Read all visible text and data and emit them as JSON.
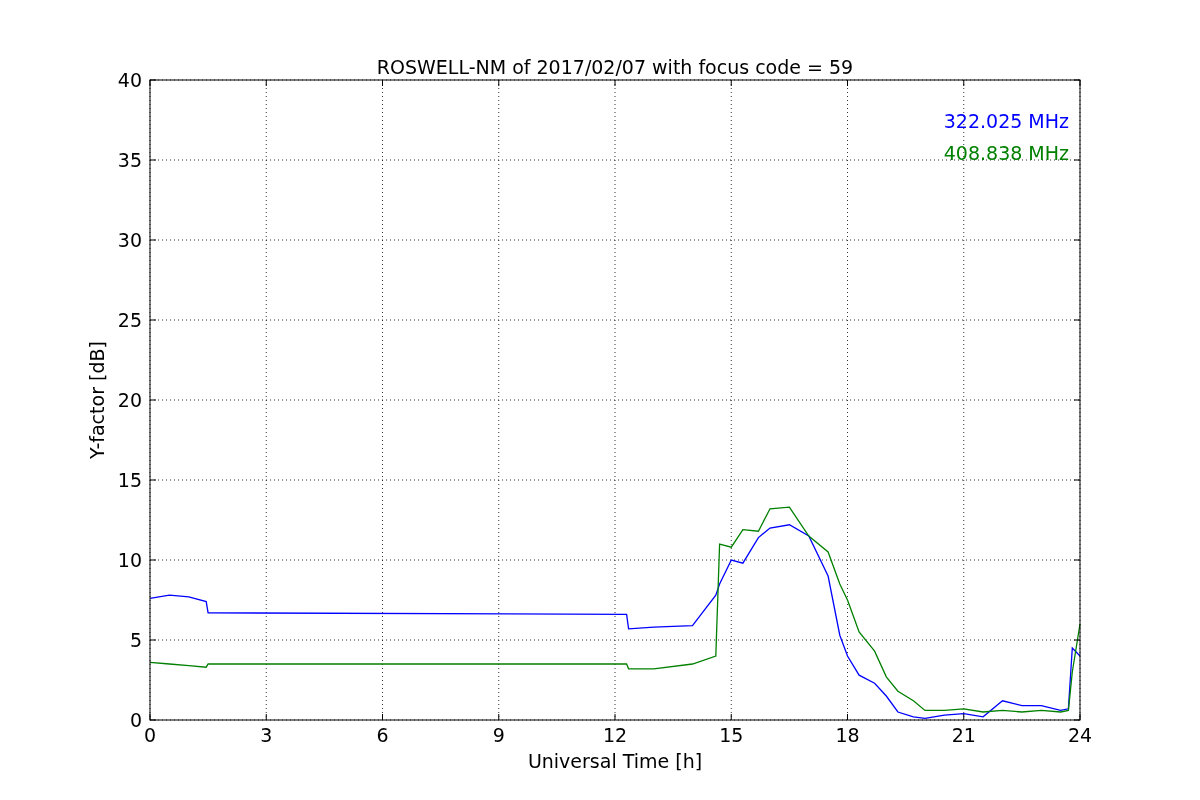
{
  "figure": {
    "chart_data": {
      "type": "line",
      "title": "ROSWELL-NM of 2017/02/07 with focus code = 59",
      "xlabel": "Universal Time [h]",
      "ylabel": "Y-factor [dB]",
      "x": [
        0,
        0.5,
        1,
        1.45,
        1.5,
        12.3,
        12.35,
        13,
        14,
        14.6,
        14.7,
        15,
        15.3,
        15.7,
        16,
        16.5,
        17,
        17.5,
        17.8,
        18,
        18.3,
        18.7,
        19,
        19.3,
        19.7,
        20,
        20.5,
        21,
        21.5,
        22,
        22.5,
        23,
        23.5,
        23.7,
        23.8,
        24
      ],
      "series": [
        {
          "name": "322.025 MHz",
          "color": "#0000ff",
          "values": [
            7.6,
            7.8,
            7.7,
            7.4,
            6.7,
            6.6,
            5.7,
            5.8,
            5.9,
            7.8,
            8.5,
            10.0,
            9.8,
            11.4,
            12.0,
            12.2,
            11.5,
            9.0,
            5.3,
            4.0,
            2.8,
            2.3,
            1.5,
            0.5,
            0.2,
            0.1,
            0.3,
            0.4,
            0.2,
            1.2,
            0.9,
            0.9,
            0.6,
            0.7,
            4.5,
            4.0
          ]
        },
        {
          "name": "408.838 MHz",
          "color": "#008000",
          "values": [
            3.6,
            3.5,
            3.4,
            3.3,
            3.5,
            3.5,
            3.2,
            3.2,
            3.5,
            4.0,
            11.0,
            10.8,
            11.9,
            11.8,
            13.2,
            13.3,
            11.5,
            10.5,
            8.5,
            7.5,
            5.5,
            4.3,
            2.7,
            1.8,
            1.2,
            0.6,
            0.6,
            0.7,
            0.5,
            0.6,
            0.5,
            0.6,
            0.5,
            0.6,
            3.0,
            6.0
          ]
        }
      ],
      "xlim": [
        0,
        24
      ],
      "ylim": [
        0,
        40
      ],
      "xticks": [
        0,
        3,
        6,
        9,
        12,
        15,
        18,
        21,
        24
      ],
      "yticks": [
        0,
        5,
        10,
        15,
        20,
        25,
        30,
        35,
        40
      ],
      "grid": true
    }
  }
}
